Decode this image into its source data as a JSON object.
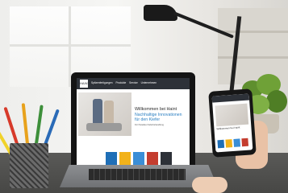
{
  "website": {
    "logo_text": "HAINT",
    "nav": [
      "Spitzenfertigungen",
      "Produkte",
      "Service",
      "Unternehmen"
    ],
    "hero_title": "Willkommen bei Haint",
    "hero_subtitle": "Nachhaltige Innovationen für den Kiefer",
    "hero_small": "Für Paradies Kieferbehandlung",
    "thumb_colors": [
      "#1f6fb7",
      "#f2b21a",
      "#3b8ed6",
      "#c43d2f",
      "#2d3138"
    ]
  },
  "phone": {
    "title": "Willkommen bei Haint"
  },
  "colors": {
    "accent_blue": "#2b7fc1",
    "header_dark": "#2d3138"
  }
}
